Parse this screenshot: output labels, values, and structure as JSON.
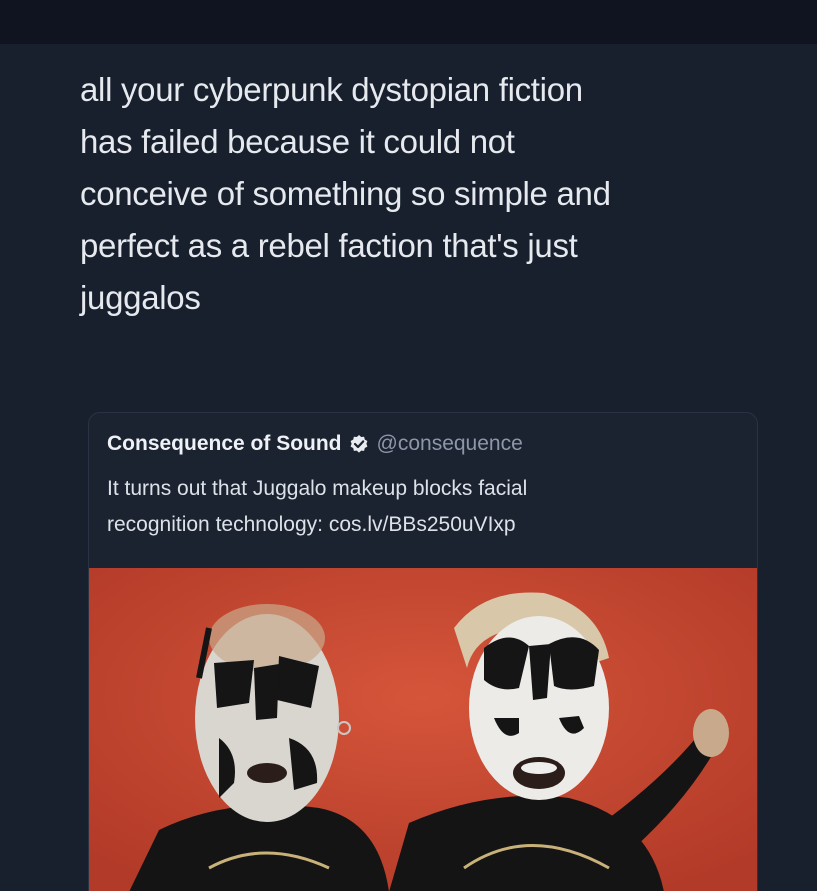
{
  "post": {
    "lines": [
      "all your cyberpunk dystopian fiction",
      "has failed because it could not",
      "conceive of something so simple and",
      "perfect as a rebel faction that's just",
      "juggalos"
    ]
  },
  "quoted_tweet": {
    "author_name": "Consequence of Sound",
    "handle": "@consequence",
    "verified_icon": "verified-badge-icon",
    "text_lines": [
      "It turns out that Juggalo makeup blocks facial",
      "recognition technology: cos.lv/BBs250uVIxp"
    ],
    "image_subject": "two-people-in-juggalo-face-paint"
  },
  "colors": {
    "background": "#18202e",
    "text": "#e6e9ee",
    "handle": "#8c97a8",
    "image_background": "#c8452f"
  }
}
